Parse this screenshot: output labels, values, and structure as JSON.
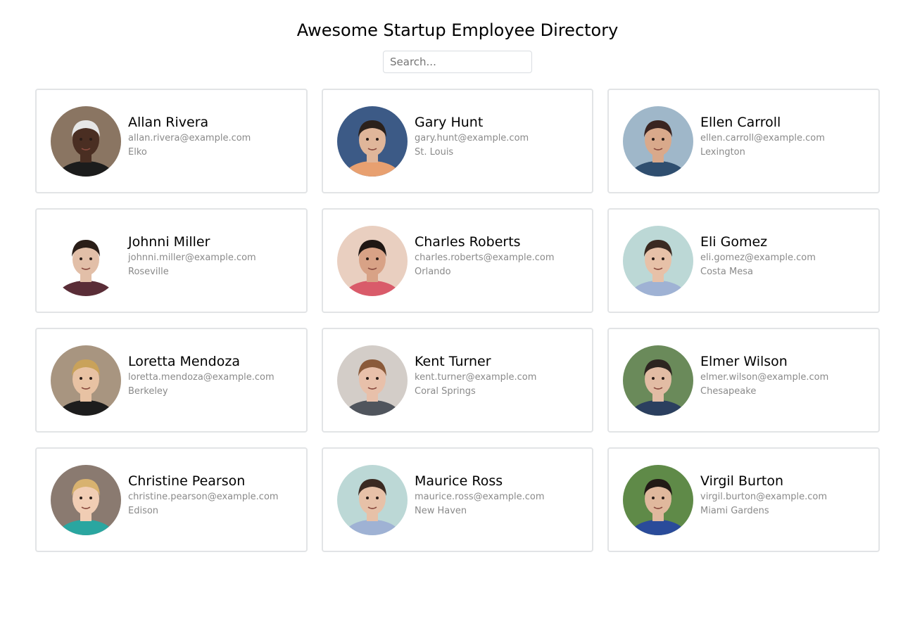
{
  "header": {
    "title": "Awesome Startup Employee Directory",
    "search_placeholder": "Search...",
    "search_value": ""
  },
  "employees": [
    {
      "name": "Allan Rivera",
      "email": "allan.rivera@example.com",
      "city": "Elko",
      "skin": "#4a2e22",
      "hair": "#e6e6e6",
      "bg": "#8a7562",
      "shirt": "#1c1c1c"
    },
    {
      "name": "Gary Hunt",
      "email": "gary.hunt@example.com",
      "city": "St. Louis",
      "skin": "#e0b69a",
      "hair": "#2b211c",
      "bg": "#3c5a86",
      "shirt": "#e8a070"
    },
    {
      "name": "Ellen Carroll",
      "email": "ellen.carroll@example.com",
      "city": "Lexington",
      "skin": "#d9a98b",
      "hair": "#3a2420",
      "bg": "#9fb7c9",
      "shirt": "#2f4e6f"
    },
    {
      "name": "Johnni Miller",
      "email": "johnni.miller@example.com",
      "city": "Roseville",
      "skin": "#e2bfa8",
      "hair": "#2a1e18",
      "bg": "#ffffff",
      "shirt": "#5a2d37"
    },
    {
      "name": "Charles Roberts",
      "email": "charles.roberts@example.com",
      "city": "Orlando",
      "skin": "#d8a286",
      "hair": "#1f1714",
      "bg": "#e9cfc0",
      "shirt": "#d95b6a"
    },
    {
      "name": "Eli Gomez",
      "email": "eli.gomez@example.com",
      "city": "Costa Mesa",
      "skin": "#e7c1a8",
      "hair": "#3b2a22",
      "bg": "#bcd8d6",
      "shirt": "#9fb2d4"
    },
    {
      "name": "Loretta Mendoza",
      "email": "loretta.mendoza@example.com",
      "city": "Berkeley",
      "skin": "#e8c2a3",
      "hair": "#c9a25a",
      "bg": "#a89580",
      "shirt": "#1d1d1d"
    },
    {
      "name": "Kent Turner",
      "email": "kent.turner@example.com",
      "city": "Coral Springs",
      "skin": "#e8c0aa",
      "hair": "#8a5a3a",
      "bg": "#d3cdc8",
      "shirt": "#50555d"
    },
    {
      "name": "Elmer Wilson",
      "email": "elmer.wilson@example.com",
      "city": "Chesapeake",
      "skin": "#e2bca4",
      "hair": "#2d2520",
      "bg": "#6a8a5a",
      "shirt": "#2b3f5f"
    },
    {
      "name": "Christine Pearson",
      "email": "christine.pearson@example.com",
      "city": "Edison",
      "skin": "#f1cdb4",
      "hair": "#d8b26f",
      "bg": "#8a7a70",
      "shirt": "#2aa6a0"
    },
    {
      "name": "Maurice Ross",
      "email": "maurice.ross@example.com",
      "city": "New Haven",
      "skin": "#e7c1a8",
      "hair": "#3b2a22",
      "bg": "#bcd8d6",
      "shirt": "#9fb2d4"
    },
    {
      "name": "Virgil Burton",
      "email": "virgil.burton@example.com",
      "city": "Miami Gardens",
      "skin": "#e0b89d",
      "hair": "#221a16",
      "bg": "#5f8a48",
      "shirt": "#2a4b9a"
    }
  ]
}
